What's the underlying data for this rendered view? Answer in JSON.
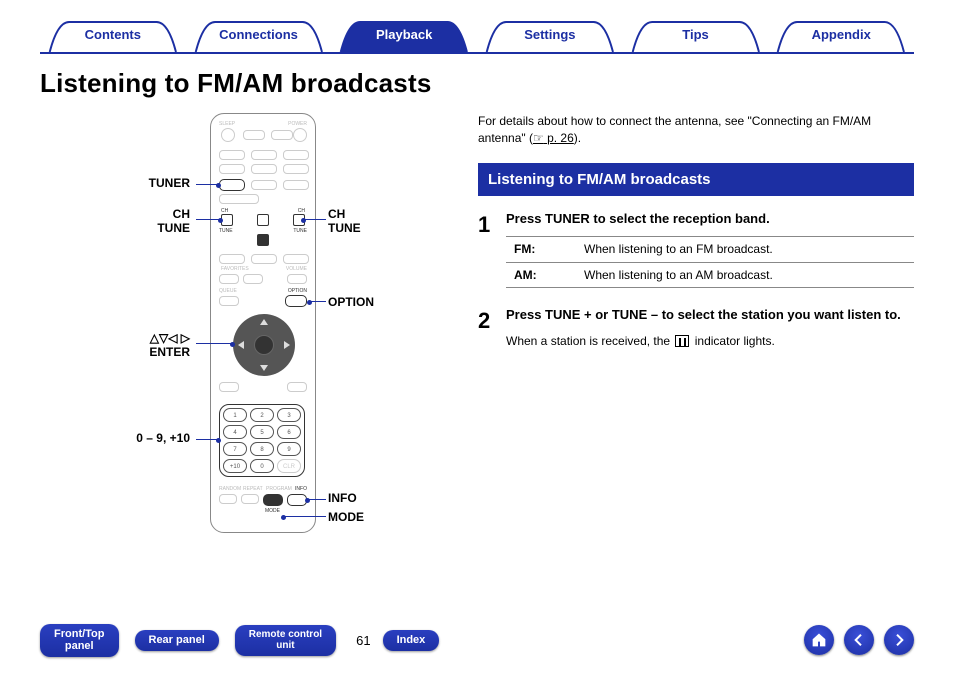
{
  "tabs": {
    "contents": "Contents",
    "connections": "Connections",
    "playback": "Playback",
    "settings": "Settings",
    "tips": "Tips",
    "appendix": "Appendix"
  },
  "page_title": "Listening to FM/AM broadcasts",
  "note": {
    "pre": "For details about how to connect the antenna, see \"Connecting an FM/AM antenna\" (",
    "linkicon": "☞",
    "link": "p. 26",
    "post": ")."
  },
  "section_heading": "Listening to FM/AM broadcasts",
  "steps": {
    "1": {
      "num": "1",
      "title": "Press TUNER to select the reception band.",
      "rows": [
        {
          "band": "FM:",
          "desc": "When listening to an FM broadcast."
        },
        {
          "band": "AM:",
          "desc": "When listening to an AM broadcast."
        }
      ]
    },
    "2": {
      "num": "2",
      "title": "Press TUNE + or TUNE – to select the station you want listen to.",
      "desc_pre": "When a station is received, the ",
      "desc_post": " indicator lights."
    }
  },
  "callouts": {
    "tuner": "TUNER",
    "ch_left": "CH",
    "tune_left": "TUNE",
    "ch_right": "CH",
    "tune_right": "TUNE",
    "option": "OPTION",
    "enter": "ENTER",
    "arrows": "△▽◁ ▷",
    "numeric": "0 – 9, +10",
    "info": "INFO",
    "mode": "MODE"
  },
  "footer": {
    "front": "Front/Top\npanel",
    "rear": "Rear panel",
    "remote": "Remote control\nunit",
    "index": "Index",
    "page": "61"
  }
}
